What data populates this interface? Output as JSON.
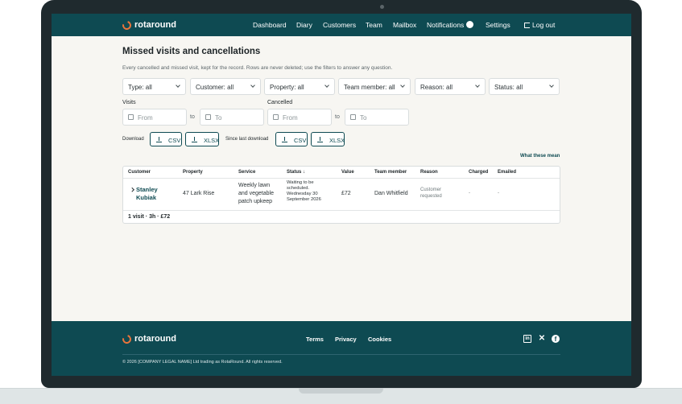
{
  "brand": {
    "name": "rotaround",
    "accent": "#e8743b",
    "primary": "#0e4a52"
  },
  "nav": {
    "items": [
      "Dashboard",
      "Diary",
      "Customers",
      "Team",
      "Mailbox",
      "Notifications",
      "Settings"
    ],
    "notifications_count": "1",
    "logout": "Log out"
  },
  "page": {
    "title": "Missed visits and cancellations",
    "subtitle": "Every cancelled and missed visit, kept for the record. Rows are never deleted; use the filters to answer any question."
  },
  "filters": {
    "type": "Type: all",
    "customer": "Customer: all",
    "property": "Property: all",
    "team_member": "Team member: all",
    "reason": "Reason: all",
    "status": "Status: all"
  },
  "dates": {
    "visits_label": "Visits",
    "cancelled_label": "Cancelled",
    "from_placeholder": "From",
    "to_placeholder": "To",
    "to_word": "to"
  },
  "downloads": {
    "label": "Download",
    "since_label": "Since last download",
    "csv": "CSV",
    "xlsx": "XLSX"
  },
  "help_link": "What these mean",
  "table": {
    "columns": [
      "Customer",
      "Property",
      "Service",
      "Status",
      "Value",
      "Team member",
      "Reason",
      "Charged",
      "Emailed"
    ],
    "status_sort_indicator": "↓",
    "rows": [
      {
        "customer_line1": "Stanley",
        "customer_line2": "Kubiak",
        "property": "47 Lark Rise",
        "service_line1": "Weekly lawn",
        "service_line2": "and vegetable",
        "service_line3": "patch upkeep",
        "status_line1": "Waiting to be",
        "status_line2": "scheduled.",
        "status_line3": "Wednesday 30",
        "status_line4": "September 2026",
        "value": "£72",
        "team_member": "Dan Whitfield",
        "reason_line1": "Customer",
        "reason_line2": "requested",
        "charged": "-",
        "emailed": "-"
      }
    ],
    "summary": "1 visit · 3h · £72"
  },
  "footer": {
    "links": [
      "Terms",
      "Privacy",
      "Cookies"
    ],
    "copyright": "© 2026 [COMPANY LEGAL NAME] Ltd trading as RotaRound. All rights reserved.",
    "social": [
      "linkedin-icon",
      "x-icon",
      "facebook-icon"
    ]
  }
}
